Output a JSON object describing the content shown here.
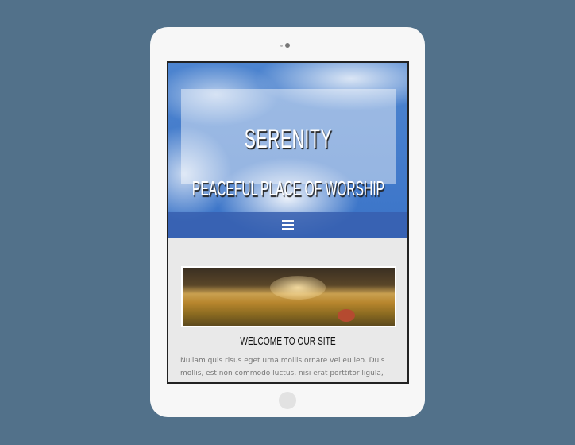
{
  "hero": {
    "title": "SERENITY",
    "subtitle": "PEACEFUL PLACE OF WORSHIP"
  },
  "nav": {
    "menu_icon": "hamburger-icon"
  },
  "content": {
    "heading": "WELCOME TO OUR SITE",
    "paragraph": "Nullam quis risus eget urna mollis ornare vel eu leo. Duis mollis, est non commodo luctus, nisi erat porttitor ligula, eget lacinia"
  },
  "colors": {
    "background": "#52718a",
    "nav": "#3f6bb5",
    "content_bg": "#e9e9e9"
  }
}
